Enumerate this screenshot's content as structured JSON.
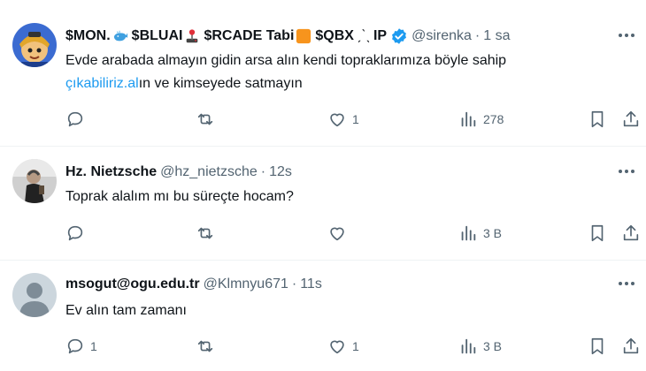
{
  "tweets": [
    {
      "name_parts": [
        "$MON.",
        "$BLUAI",
        "$RCADE Tabi",
        "$QBX",
        "IP"
      ],
      "handle": "@sirenka",
      "time": "1 sa",
      "text_before": "Evde arabada almayın gidin arsa alın kendi topraklarımıza böyle sahip",
      "link": "çıkabiliriz.al",
      "text_after": "ın ve kimseyede satmayın",
      "replies": "",
      "reposts": "",
      "likes": "1",
      "views": "278",
      "verified": true
    },
    {
      "name": "Hz. Nietzsche",
      "handle": "@hz_nietzsche",
      "time": "12s",
      "text": "Toprak alalım mı bu süreçte hocam?",
      "replies": "",
      "reposts": "",
      "likes": "",
      "views": "3 B"
    },
    {
      "name": "msogut@ogu.edu.tr",
      "handle": "@Klmnyu671",
      "time": "11s",
      "text": "Ev alın tam zamanı",
      "replies": "1",
      "reposts": "",
      "likes": "1",
      "views": "3 B"
    }
  ],
  "separator": "·",
  "colors": {
    "text": "#0f1419",
    "secondary": "#536471",
    "link": "#1d9bf0",
    "divider": "#eff3f4",
    "verified": "#1d9bf0"
  }
}
